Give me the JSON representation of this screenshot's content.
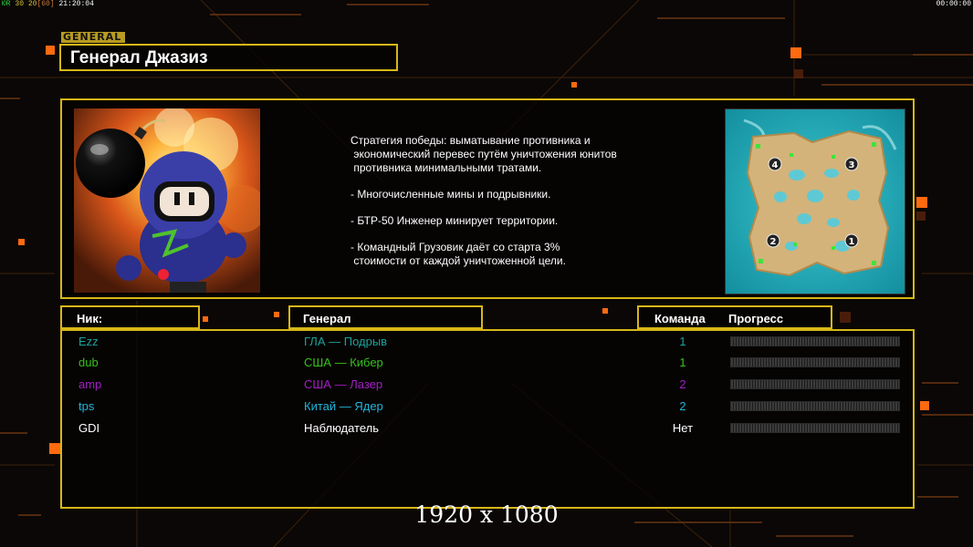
{
  "hud": {
    "fps_label": "ЮR",
    "fps_a": "30",
    "fps_b": "20",
    "fps_c": "[60]",
    "clock": "21:20:04",
    "timer": "00:00:00"
  },
  "general_tag": "GENERAL",
  "title": "Генерал Джазиз",
  "description": [
    "Стратегия победы: выматывание противника и",
    " экономический перевес путём уничтожения юнитов",
    " противника минимальными тратами.",
    "",
    "- Многочисленные мины и подрывники.",
    "",
    "- БТР-50 Инженер минирует территории.",
    "",
    "- Командный Грузовик даёт со старта 3%",
    " стоимости от каждой уничтоженной цели."
  ],
  "columns": {
    "nick": "Ник:",
    "general": "Генерал",
    "team": "Команда",
    "progress": "Прогресс"
  },
  "players": [
    {
      "nick": "Ezz",
      "general": "ГЛА — Подрыв",
      "team": "1",
      "color": "#1aa39c",
      "progress": 0
    },
    {
      "nick": "dub",
      "general": "США — Кибер",
      "team": "1",
      "color": "#35c21a",
      "progress": 0
    },
    {
      "nick": "amp",
      "general": "США — Лазер",
      "team": "2",
      "color": "#a21fc4",
      "progress": 0
    },
    {
      "nick": "tps",
      "general": "Китай — Ядер",
      "team": "2",
      "color": "#1fb6d8",
      "progress": 0
    },
    {
      "nick": "GDI",
      "general": "Наблюдатель",
      "team": "Нет",
      "color": "#ffffff",
      "progress": null
    }
  ],
  "minimap": {
    "start_positions": [
      "1",
      "2",
      "3",
      "4"
    ]
  },
  "resolution": "1920 x 1080",
  "colors": {
    "accent": "#d7b718",
    "background": "#0a0706",
    "grid": "#3a1d08"
  }
}
